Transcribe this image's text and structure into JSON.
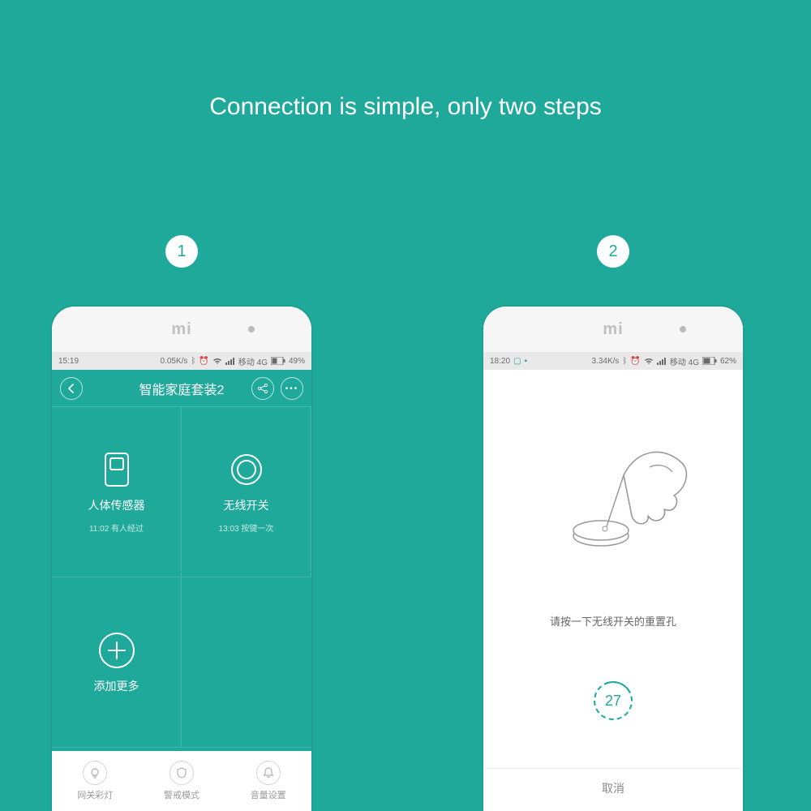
{
  "headline": "Connection is simple, only two steps",
  "steps": {
    "one": "1",
    "two": "2"
  },
  "brand": "mi",
  "phone1": {
    "status": {
      "time": "15:19",
      "speed": "0.05K/s",
      "network": "移动 4G",
      "battery": "49%"
    },
    "header": {
      "title": "智能家庭套装2"
    },
    "tiles": [
      {
        "label": "人体传感器",
        "sub": "11:02 有人经过"
      },
      {
        "label": "无线开关",
        "sub": "13:03 按键一次"
      },
      {
        "label": "添加更多",
        "sub": ""
      }
    ],
    "bottom": [
      {
        "label": "网关彩灯"
      },
      {
        "label": "警戒模式"
      },
      {
        "label": "音量设置"
      }
    ]
  },
  "phone2": {
    "status": {
      "time": "18:20",
      "speed": "3.34K/s",
      "network": "移动 4G",
      "battery": "62%"
    },
    "instruction": "请按一下无线开关的重置孔",
    "countdown": "27",
    "cancel": "取消"
  }
}
